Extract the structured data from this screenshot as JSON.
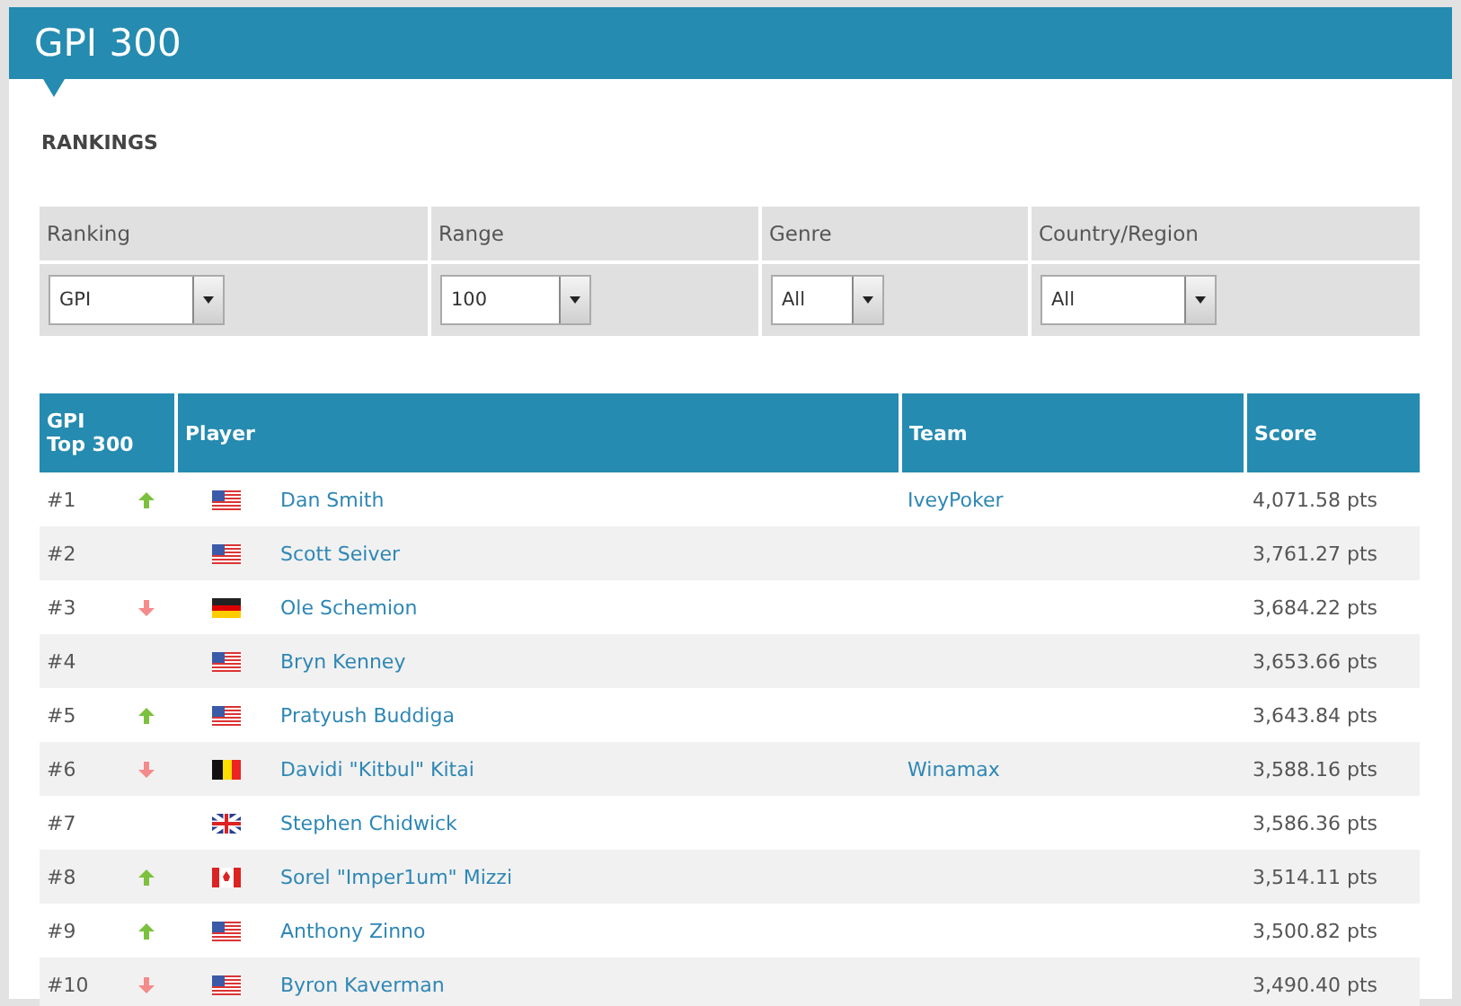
{
  "header": {
    "title": "GPI 300"
  },
  "section_title": "RANKINGS",
  "filters": [
    {
      "label": "Ranking",
      "value": "GPI"
    },
    {
      "label": "Range",
      "value": "100"
    },
    {
      "label": "Genre",
      "value": "All"
    },
    {
      "label": "Country/Region",
      "value": "All"
    }
  ],
  "table": {
    "columns": [
      "GPI\nTop 300",
      "Player",
      "Team",
      "Score"
    ],
    "rows": [
      {
        "rank": "#1",
        "trend": {
          "kind": "up"
        },
        "flag": {
          "kind": "us"
        },
        "player": "Dan Smith",
        "team": "IveyPoker",
        "score": "4,071.58 pts"
      },
      {
        "rank": "#2",
        "trend": {
          "kind": "none"
        },
        "flag": {
          "kind": "us"
        },
        "player": "Scott Seiver",
        "score": "3,761.27 pts"
      },
      {
        "rank": "#3",
        "trend": {
          "kind": "down"
        },
        "flag": {
          "kind": "de"
        },
        "player": "Ole Schemion",
        "score": "3,684.22 pts"
      },
      {
        "rank": "#4",
        "trend": {
          "kind": "none"
        },
        "flag": {
          "kind": "us"
        },
        "player": "Bryn Kenney",
        "score": "3,653.66 pts"
      },
      {
        "rank": "#5",
        "trend": {
          "kind": "up"
        },
        "flag": {
          "kind": "us"
        },
        "player": "Pratyush Buddiga",
        "score": "3,643.84 pts"
      },
      {
        "rank": "#6",
        "trend": {
          "kind": "down"
        },
        "flag": {
          "kind": "be"
        },
        "player": "Davidi \"Kitbul\" Kitai",
        "team": "Winamax",
        "score": "3,588.16 pts"
      },
      {
        "rank": "#7",
        "trend": {
          "kind": "none"
        },
        "flag": {
          "kind": "gb"
        },
        "player": "Stephen Chidwick",
        "score": "3,586.36 pts"
      },
      {
        "rank": "#8",
        "trend": {
          "kind": "up"
        },
        "flag": {
          "kind": "ca"
        },
        "player": "Sorel \"Imper1um\" Mizzi",
        "score": "3,514.11 pts"
      },
      {
        "rank": "#9",
        "trend": {
          "kind": "up"
        },
        "flag": {
          "kind": "us"
        },
        "player": "Anthony Zinno",
        "score": "3,500.82 pts"
      },
      {
        "rank": "#10",
        "trend": {
          "kind": "down"
        },
        "flag": {
          "kind": "us"
        },
        "player": "Byron Kaverman",
        "score": "3,490.40 pts"
      }
    ]
  }
}
